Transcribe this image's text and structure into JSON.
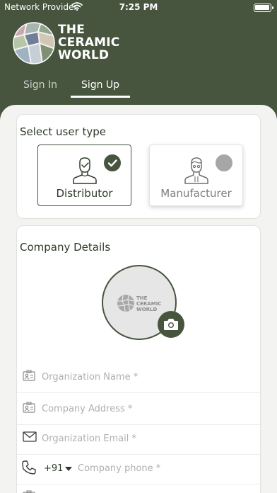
{
  "status": {
    "provider": "Network Provider",
    "time": "7:25 PM",
    "battery_level": 0.95
  },
  "brand": {
    "line1": "THE",
    "line2": "CERAMIC",
    "line3": "WORLD"
  },
  "tabs": [
    {
      "label": "Sign In",
      "active": false
    },
    {
      "label": "Sign Up",
      "active": true
    }
  ],
  "user_type": {
    "title": "Select user type",
    "options": [
      {
        "label": "Distributor",
        "selected": true,
        "icon": "distributor-icon"
      },
      {
        "label": "Manufacturer",
        "selected": false,
        "icon": "manufacturer-icon"
      }
    ]
  },
  "company": {
    "title": "Company Details",
    "logo": {
      "line1": "THE",
      "line2": "CERAMIC",
      "line3": "WORLD"
    },
    "fields": [
      {
        "placeholder": "Organization Name *",
        "icon": "id-card-icon"
      },
      {
        "placeholder": "Company Address *",
        "icon": "id-card-icon"
      },
      {
        "placeholder": "Organization Email *",
        "icon": "mail-icon"
      },
      {
        "placeholder": "Company phone *",
        "icon": "phone-icon",
        "country_code": "+91"
      }
    ]
  },
  "colors": {
    "primary": "#47553F",
    "background": "#F3F4F2",
    "muted": "#AFAFAF"
  }
}
